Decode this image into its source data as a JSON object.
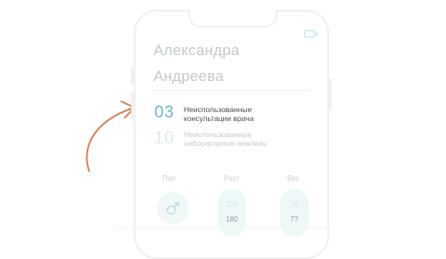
{
  "profile": {
    "first_name": "Александра",
    "last_name": "Андреева"
  },
  "stats": [
    {
      "count": "03",
      "label_line1": "Неиспользованные",
      "label_line2": "консультации врача",
      "color": "#6bb8c6",
      "label_color": "#4a4f52"
    },
    {
      "count": "10",
      "label_line1": "Неиспользованные",
      "label_line2": "лабораторные анализы",
      "color": "#d6edf1",
      "label_color": "#c5cacd"
    }
  ],
  "metrics": {
    "sex": {
      "label": "Пол",
      "icon": "male-symbol-icon"
    },
    "height": {
      "label": "Рост",
      "prev": "170",
      "current": "180"
    },
    "weight": {
      "label": "Вес",
      "prev": "76",
      "current": "77"
    }
  },
  "colors": {
    "accent": "#6bb8c6",
    "arrow": "#d7845a",
    "muted_text": "#c4c9cc"
  }
}
